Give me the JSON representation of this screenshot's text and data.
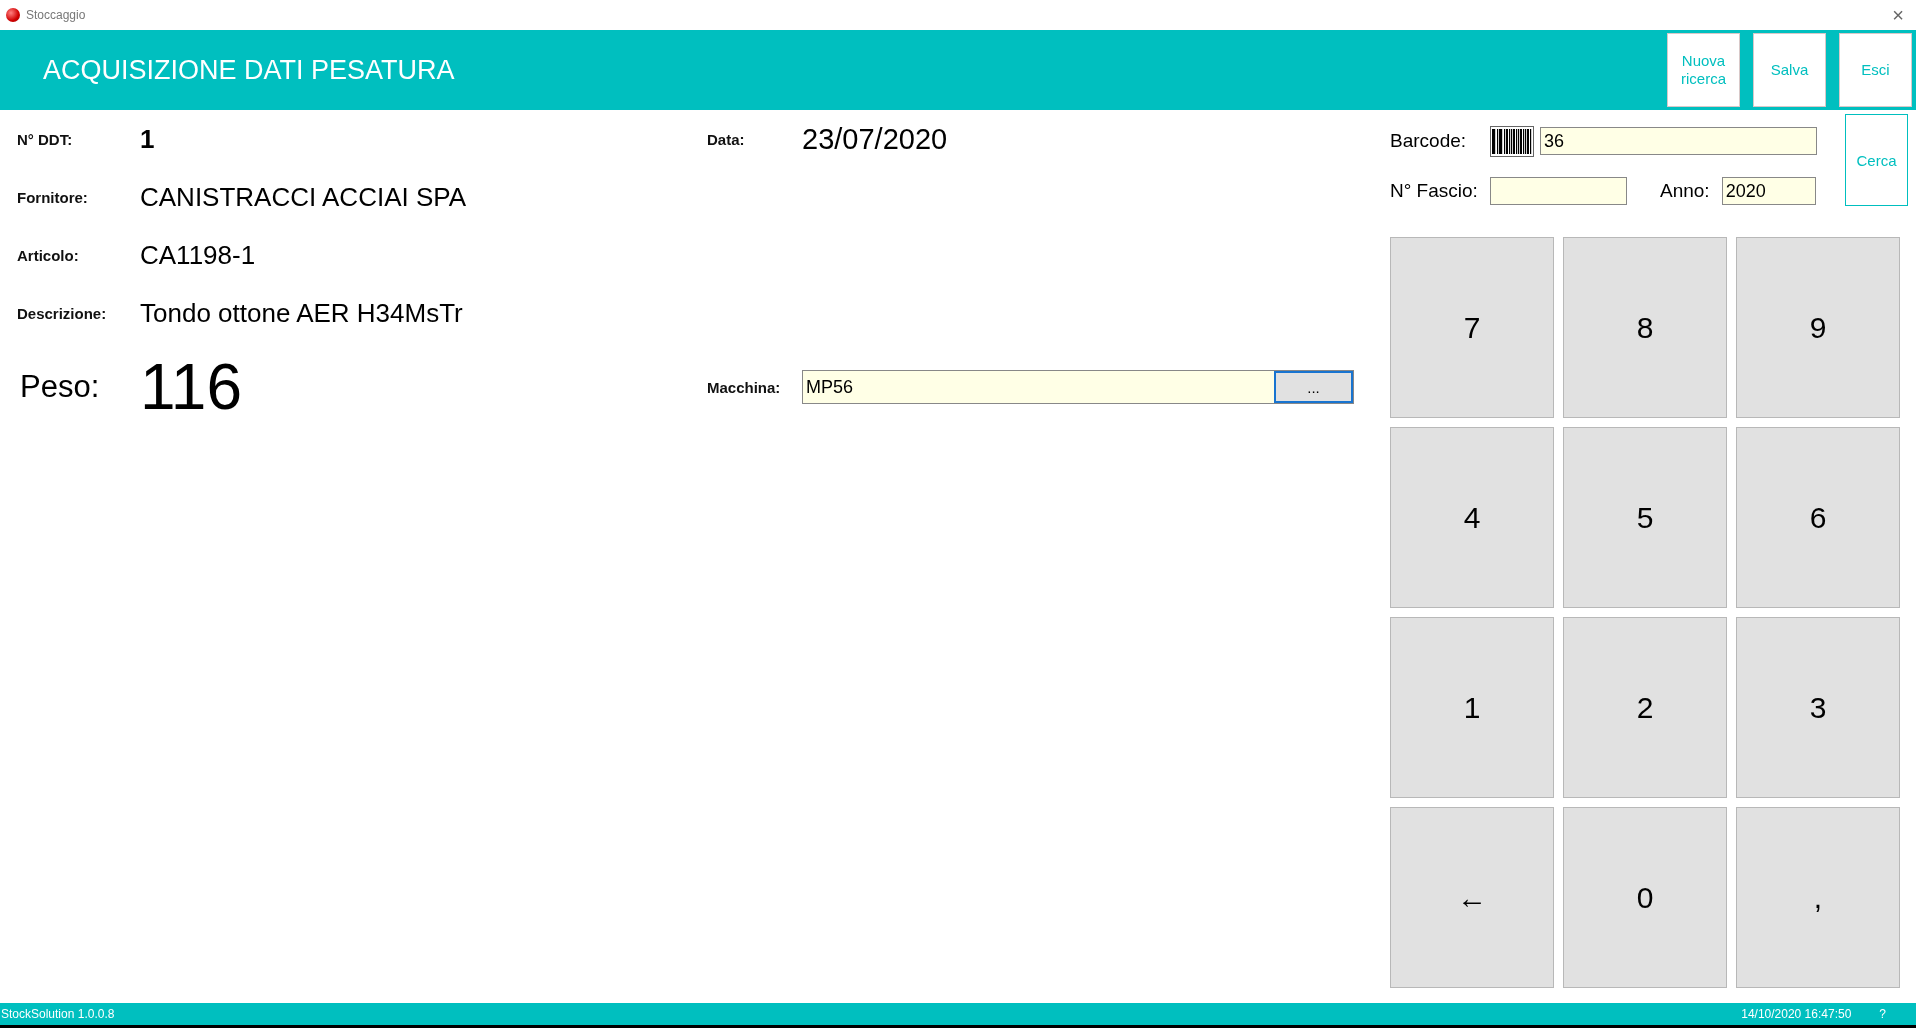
{
  "window": {
    "title": "Stoccaggio",
    "close": "×"
  },
  "header": {
    "title": "ACQUISIZIONE DATI PESATURA",
    "buttons": [
      "Nuova ricerca",
      "Salva",
      "Esci"
    ]
  },
  "form": {
    "ddt": {
      "label": "N° DDT:",
      "value": "1"
    },
    "data": {
      "label": "Data:",
      "value": "23/07/2020"
    },
    "fornitore": {
      "label": "Fornitore:",
      "value": "CANISTRACCI ACCIAI SPA"
    },
    "articolo": {
      "label": "Articolo:",
      "value": "CA1198-1"
    },
    "descrizione": {
      "label": "Descrizione:",
      "value": "Tondo ottone AER H34MsTr"
    },
    "peso": {
      "label": "Peso:",
      "value": "116"
    },
    "macchina": {
      "label": "Macchina:",
      "value": "MP56",
      "button": "..."
    }
  },
  "search": {
    "barcode": {
      "label": "Barcode:",
      "value": "36"
    },
    "fascio": {
      "label": "N° Fascio:"
    },
    "anno": {
      "label": "Anno:",
      "value": "2020"
    },
    "button": "Cerca"
  },
  "keypad": [
    "7",
    "8",
    "9",
    "4",
    "5",
    "6",
    "1",
    "2",
    "3",
    "←",
    "0",
    ","
  ],
  "status_bar": {
    "version": "StockSolution 1.0.0.8",
    "datetime": "14/10/2020 16:47:50",
    "help": "?"
  }
}
